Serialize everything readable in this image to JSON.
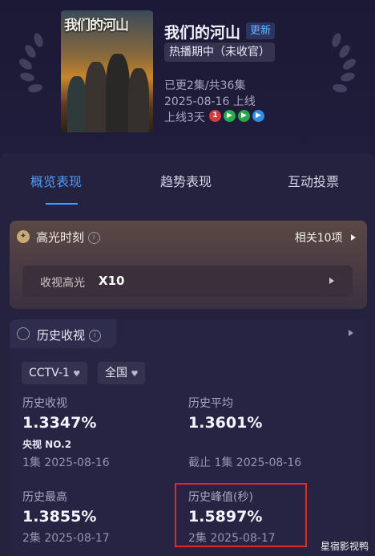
{
  "show": {
    "poster_text": "我们的河山",
    "title": "我们的河山",
    "new_badge": "更新",
    "status": "热播期中（未收官）",
    "episodes": "已更2集/共36集",
    "premiere_date": "2025-08-16 上线",
    "days_online": "上线3天",
    "platform_icons": [
      "cctv-icon",
      "iqiyi-icon",
      "tencent-video-icon",
      "youku-icon"
    ]
  },
  "tabs": [
    {
      "label": "概览表现",
      "active": true
    },
    {
      "label": "趋势表现",
      "active": false
    },
    {
      "label": "互动投票",
      "active": false
    }
  ],
  "highlight": {
    "title": "高光时刻",
    "related": "相关10项",
    "row_label": "收视高光",
    "row_count": "X10"
  },
  "history": {
    "title": "历史收视",
    "channel": "CCTV-1",
    "region": "全国",
    "stats": [
      {
        "label": "历史收视",
        "value": "1.3347%",
        "rank": "央视 NO.2",
        "date": "1集 2025-08-16"
      },
      {
        "label": "历史平均",
        "value": "1.3601%",
        "date": "截止 1集 2025-08-16"
      },
      {
        "label": "历史最高",
        "value": "1.3855%",
        "date": "2集 2025-08-17"
      },
      {
        "label": "历史峰值(秒)",
        "value": "1.5897%",
        "date": "2集 2025-08-17"
      }
    ]
  },
  "watermark": "星宿影视鸭",
  "colors": {
    "accent": "#4c9bff",
    "highlight_box": "#e02a2a",
    "background": "#1c1a36"
  }
}
